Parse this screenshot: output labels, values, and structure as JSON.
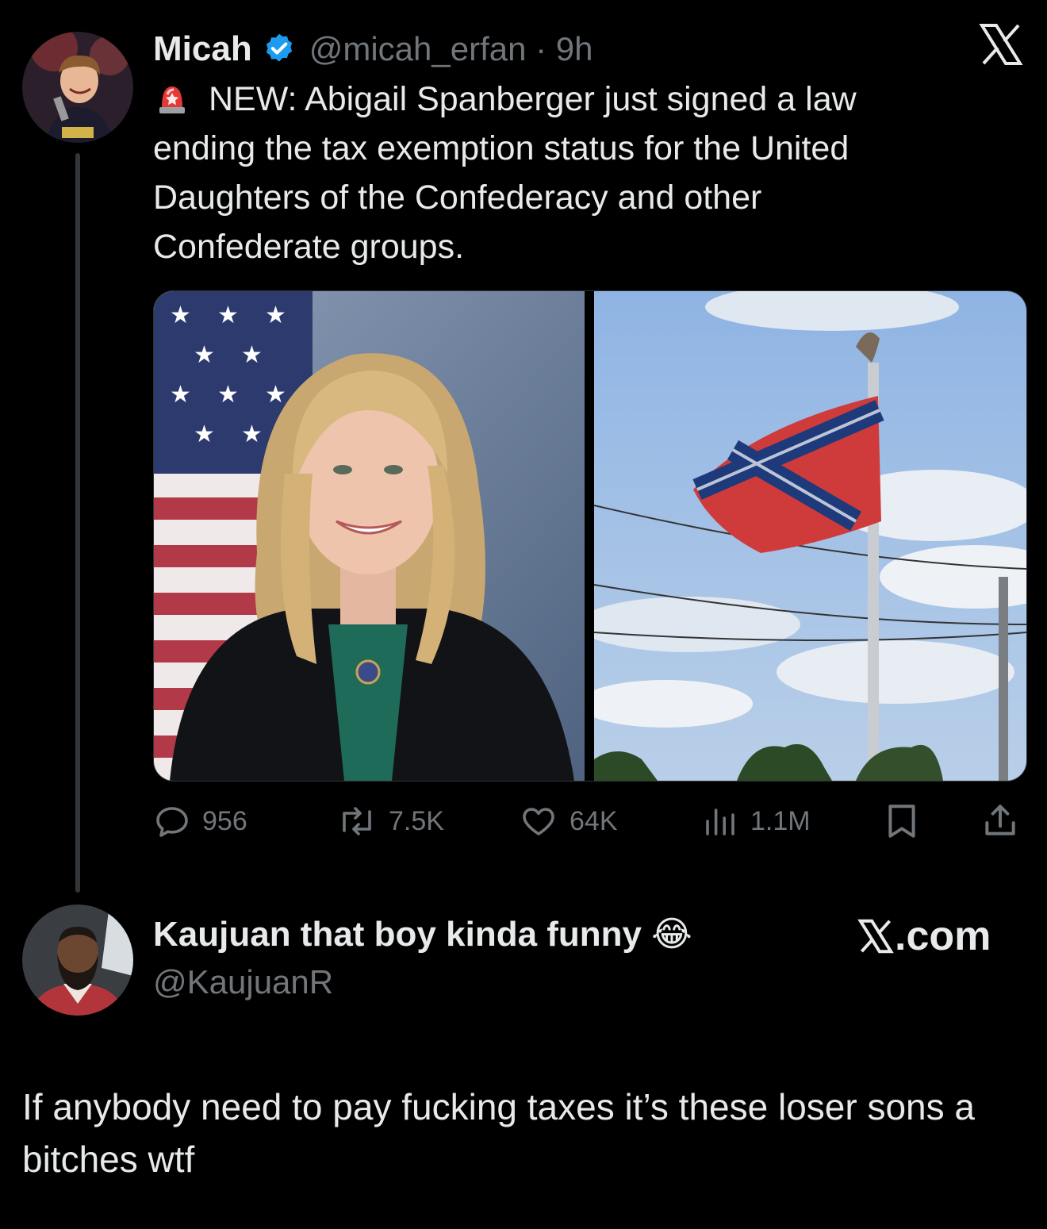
{
  "tweet": {
    "author_name": "Micah",
    "handle_time": "@micah_erfan · 9h",
    "text": "NEW: Abigail Spanberger just signed a law ending the tax exemption status for the United Daughters of the Confederacy and other Confederate groups.",
    "stats": {
      "replies": "956",
      "reposts": "7.5K",
      "likes": "64K",
      "views": "1.1M"
    }
  },
  "reply": {
    "author_name": "Kaujuan that boy kinda funny 😂",
    "handle": "@KaujuanR",
    "text": "If anybody need to pay fucking taxes it’s these loser sons a bitches wtf"
  },
  "branding": {
    "x_logo": "𝕏",
    "x_com": "X.com"
  },
  "icons": {
    "verified": "verified-badge-icon",
    "siren": "siren-emoji-icon",
    "reply": "reply-bubble-icon",
    "repost": "repost-icon",
    "like": "heart-icon",
    "views": "views-chart-icon",
    "bookmark": "bookmark-icon",
    "share": "share-icon"
  },
  "colors": {
    "background": "#000000",
    "text": "#e7e9ea",
    "muted": "#71767b",
    "verified": "#1d9bf0"
  }
}
